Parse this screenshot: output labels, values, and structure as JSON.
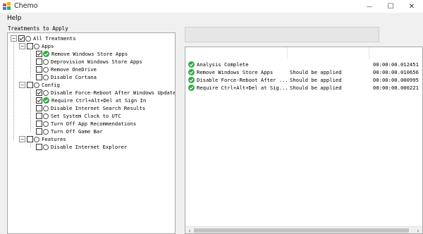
{
  "window": {
    "title": "Chemo",
    "minimize_glyph": "—",
    "maximize_glyph": "☐",
    "close_glyph": "✕"
  },
  "menu": {
    "help": "Help"
  },
  "treatments": {
    "label": "Treatments to Apply",
    "root": "All Treatments",
    "groups": [
      {
        "name": "Apps",
        "items": [
          {
            "label": "Remove Windows Store Apps",
            "checked": true,
            "status": "ok"
          },
          {
            "label": "Deprovision Windows Store Apps",
            "checked": false,
            "status": "none"
          },
          {
            "label": "Remove OneDrive",
            "checked": false,
            "status": "none"
          },
          {
            "label": "Disable Cortana",
            "checked": false,
            "status": "none"
          }
        ]
      },
      {
        "name": "Config",
        "items": [
          {
            "label": "Disable Force-Reboot After Windows Update",
            "checked": true,
            "status": "none"
          },
          {
            "label": "Require Ctrl+Alt+Del at Sign In",
            "checked": true,
            "status": "ok"
          },
          {
            "label": "Disable Internet Search Results",
            "checked": false,
            "status": "none"
          },
          {
            "label": "Set System Clock to UTC",
            "checked": false,
            "status": "none"
          },
          {
            "label": "Turn Off App Recommendations",
            "checked": false,
            "status": "none"
          },
          {
            "label": "Turn Off Game Bar",
            "checked": false,
            "status": "none"
          }
        ]
      },
      {
        "name": "Features",
        "items": [
          {
            "label": "Disable Internet Explorer",
            "checked": false,
            "status": "none"
          }
        ]
      }
    ]
  },
  "results": {
    "rows": [
      {
        "name": "Analysis Complete",
        "status": "",
        "time": "00:00:00.012451"
      },
      {
        "name": "Remove Windows Store Apps",
        "status": "Should be applied",
        "time": "00:00:00.010656"
      },
      {
        "name": "Disable Force-Reboot After ...",
        "status": "Should be applied",
        "time": "00:00:00.000995"
      },
      {
        "name": "Require Ctrl+Alt+Del at Sig...",
        "status": "Should be applied",
        "time": "00:00:00.000221"
      }
    ],
    "scroll_left": "‹",
    "scroll_right": "›"
  },
  "colors": {
    "ok_green": "#2eaa43",
    "border": "#a8a8a8",
    "window_bg": "#f0f0f0"
  }
}
